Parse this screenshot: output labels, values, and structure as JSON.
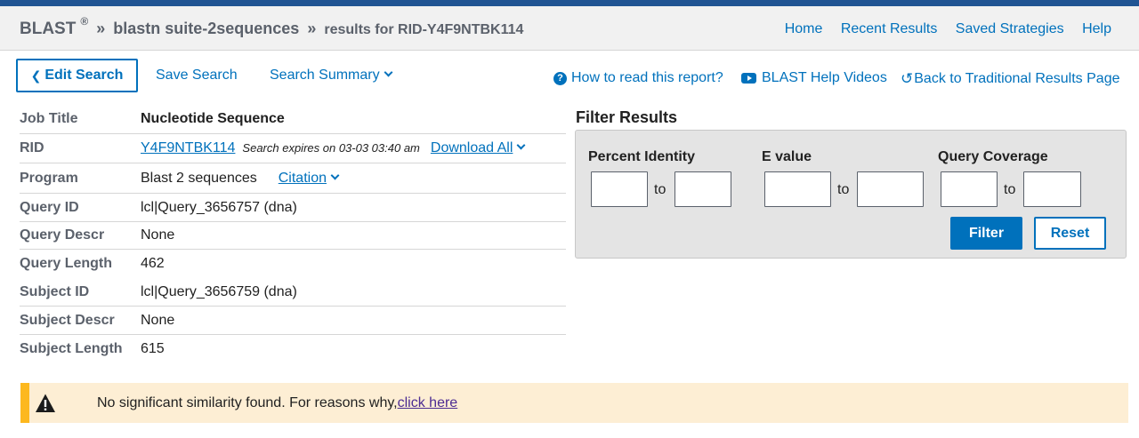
{
  "breadcrumb": {
    "brand": "BLAST",
    "reg": "®",
    "sep": "»",
    "program": "blastn suite-2sequences",
    "results": "results for RID-Y4F9NTBK114"
  },
  "topnav": [
    "Home",
    "Recent Results",
    "Saved Strategies",
    "Help"
  ],
  "actions": {
    "edit": "Edit Search",
    "save": "Save Search",
    "summary": "Search Summary"
  },
  "help": {
    "how_to": "How to read this report?",
    "videos": "BLAST Help Videos",
    "back": "Back to Traditional Results Page"
  },
  "job": {
    "rows": [
      {
        "label": "Job Title",
        "value": "Nucleotide Sequence"
      },
      {
        "label": "RID",
        "value": "Y4F9NTBK114",
        "expires": "Search expires on 03-03 03:40 am",
        "download": "Download All"
      },
      {
        "label": "Program",
        "value": "Blast 2 sequences",
        "citation": "Citation"
      },
      {
        "label": "Query ID",
        "value": "lcl|Query_3656757 (dna)"
      },
      {
        "label": "Query Descr",
        "value": "None"
      },
      {
        "label": "Query Length",
        "value": "462"
      },
      {
        "label": "Subject ID",
        "value": "lcl|Query_3656759 (dna)"
      },
      {
        "label": "Subject Descr",
        "value": "None"
      },
      {
        "label": "Subject Length",
        "value": "615"
      }
    ]
  },
  "filter": {
    "title": "Filter Results",
    "percent_identity": "Percent Identity",
    "e_value": "E value",
    "query_coverage": "Query Coverage",
    "to": "to",
    "filter_btn": "Filter",
    "reset_btn": "Reset"
  },
  "alert": {
    "text": "No significant similarity found. For reasons why,",
    "link": "click here"
  },
  "colors": {
    "accent": "#0071bc",
    "topbar": "#205493",
    "alert_bg": "#fdeed4",
    "alert_border": "#fdb81e"
  }
}
